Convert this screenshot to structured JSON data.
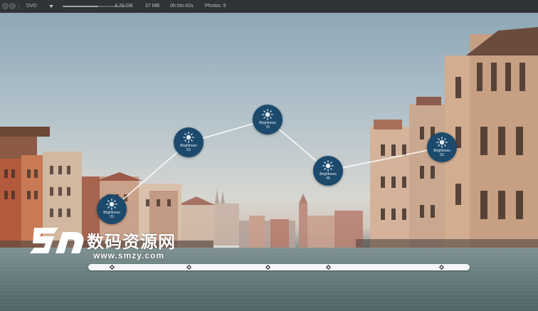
{
  "toolbar": {
    "format": "DVD",
    "disk_usage": "4.70 GB",
    "file_size": "37 MB",
    "duration": "0h:0m:42s",
    "photos": "Photos: 6",
    "usage_fraction": 0.55
  },
  "keyframes": [
    {
      "label": "Brightness",
      "value": "23"
    },
    {
      "label": "Brightness",
      "value": "63"
    },
    {
      "label": "Brightness",
      "value": "76"
    },
    {
      "label": "Brightness",
      "value": "46"
    },
    {
      "label": "Brightness",
      "value": "52"
    }
  ],
  "watermark": {
    "text_zh": "数码资源网",
    "url": "www.smzy.com"
  },
  "colors": {
    "keyframe_fill": "#1c4a6d",
    "connector": "#ffffff",
    "timeline": "#f4f6f7",
    "toolbar_bg": "#2f3336"
  },
  "icons": {
    "keyframe": "sun-icon",
    "timeline_marker": "diamond-icon"
  }
}
